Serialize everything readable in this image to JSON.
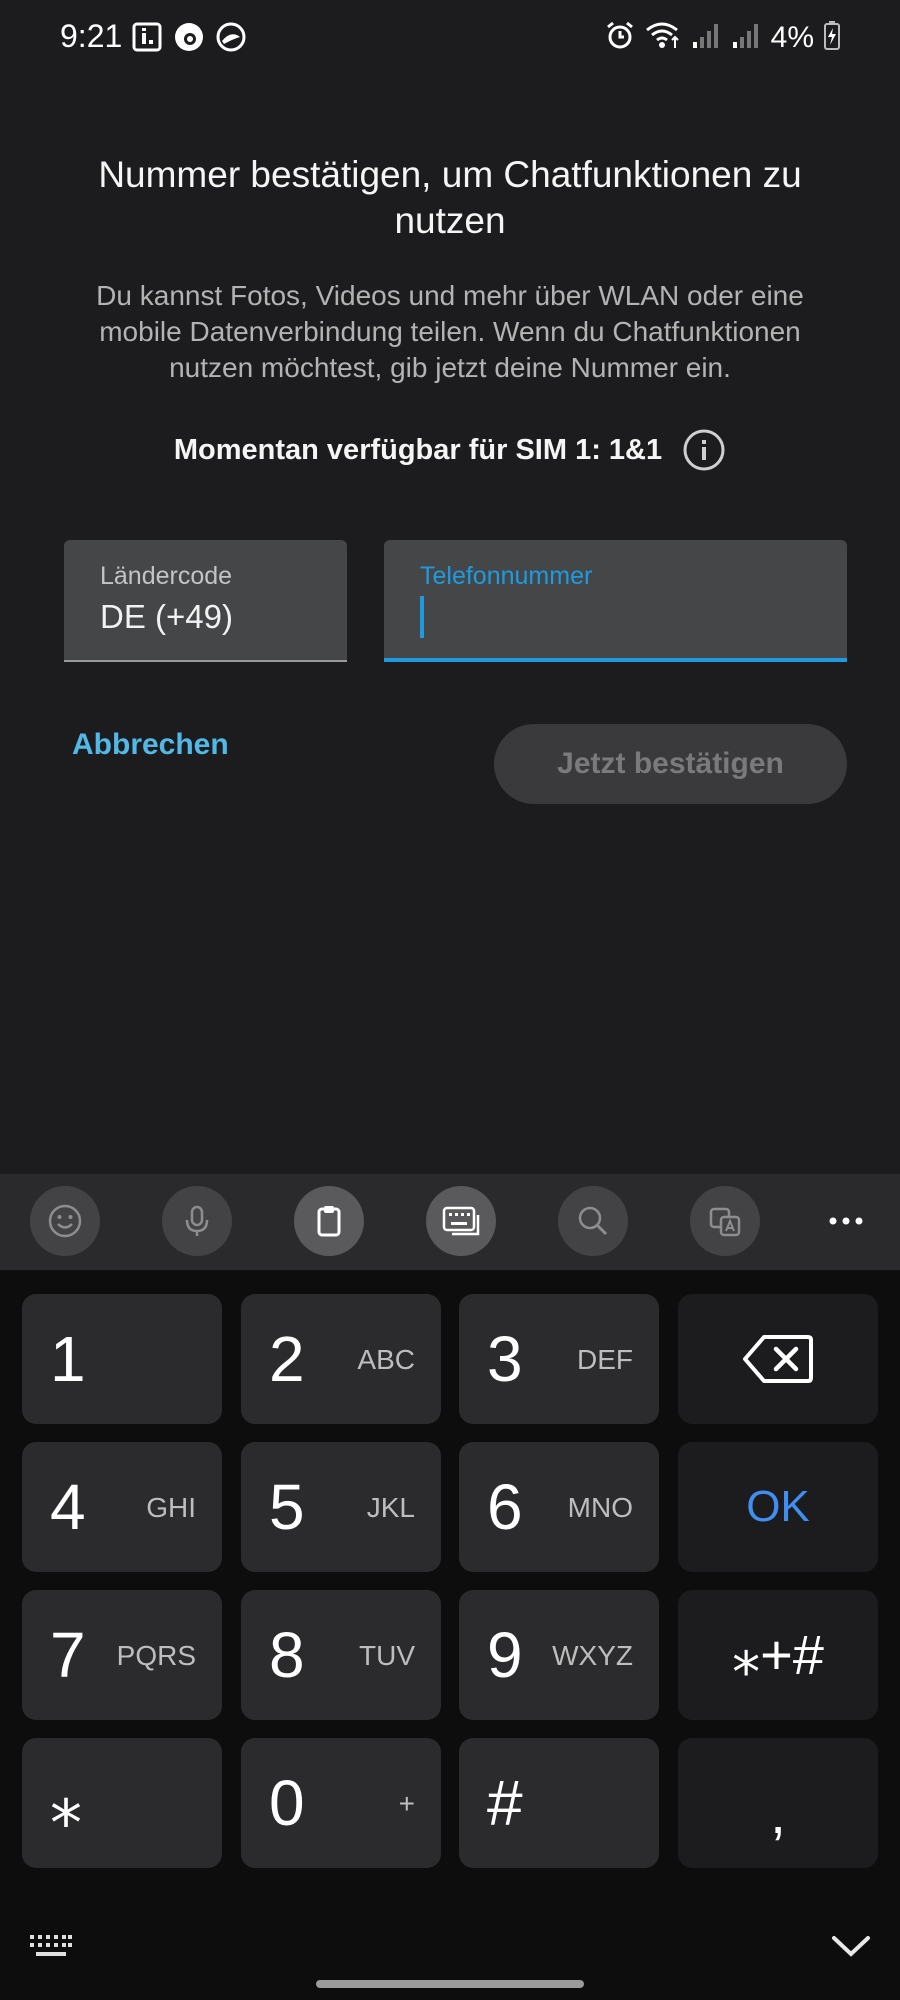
{
  "status_bar": {
    "time": "9:21",
    "battery_percent": "4%",
    "left_icons": [
      "info-notification-icon",
      "vodafone-icon",
      "app-notification-icon"
    ],
    "right_icons": [
      "alarm-icon",
      "wifi-icon",
      "signal-icon",
      "signal-icon",
      "battery-charging-icon"
    ]
  },
  "header": {
    "title": "Nummer bestätigen, um Chatfunktionen zu nutzen",
    "description": "Du kannst Fotos, Videos und mehr über WLAN oder eine mobile Datenverbindung teilen. Wenn du Chatfunktionen nutzen möchtest, gib jetzt deine Nummer ein.",
    "sim_info": "Momentan verfügbar für SIM 1: 1&1"
  },
  "form": {
    "country_label": "Ländercode",
    "country_value": "DE (+49)",
    "phone_label": "Telefonnummer",
    "phone_value": ""
  },
  "actions": {
    "cancel": "Abbrechen",
    "confirm": "Jetzt bestätigen"
  },
  "keyboard_toolbar": {
    "icons": [
      "emoji-icon",
      "microphone-icon",
      "clipboard-icon",
      "keyboard-mode-icon",
      "search-icon",
      "translate-icon",
      "more-icon"
    ]
  },
  "keypad": {
    "keys": [
      {
        "digit": "1",
        "letters": ""
      },
      {
        "digit": "2",
        "letters": "ABC"
      },
      {
        "digit": "3",
        "letters": "DEF"
      },
      {
        "digit": "4",
        "letters": "GHI"
      },
      {
        "digit": "5",
        "letters": "JKL"
      },
      {
        "digit": "6",
        "letters": "MNO"
      },
      {
        "digit": "7",
        "letters": "PQRS"
      },
      {
        "digit": "8",
        "letters": "TUV"
      },
      {
        "digit": "9",
        "letters": "WXYZ"
      },
      {
        "digit": "0",
        "letters": "+"
      }
    ],
    "ok": "OK",
    "symbols": "⁎+#",
    "star": "⁎",
    "hash": "#",
    "comma": ","
  },
  "colors": {
    "accent": "#1e9be0",
    "link": "#52b8e6",
    "ok": "#3f8ef0",
    "background": "#1c1c1e"
  }
}
